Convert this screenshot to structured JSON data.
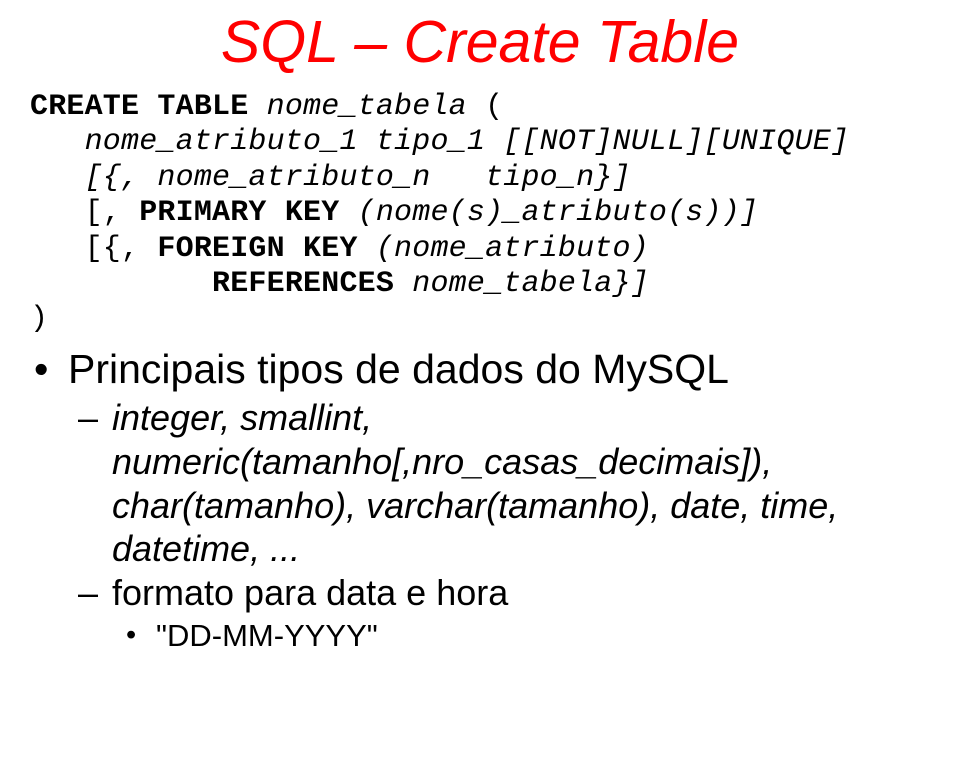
{
  "title": "SQL – Create Table",
  "code": {
    "l1a": "CREATE TABLE ",
    "l1b": "nome_tabela",
    "l1c": " (",
    "l2": "   nome_atributo_1 tipo_1 [[NOT]NULL][UNIQUE]",
    "l3": "   [{, nome_atributo_n   tipo_n}]",
    "l4a": "   [, ",
    "l4b": "PRIMARY KEY ",
    "l4c": "(nome(s)_atributo(s))]",
    "l5a": "   [{, ",
    "l5b": "FOREIGN KEY ",
    "l5c": "(nome_atributo)",
    "l6a": "          ",
    "l6b": "REFERENCES ",
    "l6c": "nome_tabela}]",
    "l7": ")"
  },
  "bullets": {
    "main": "Principais tipos de dados do MySQL",
    "sub1": "integer, smallint, numeric(tamanho[,nro_casas_decimais]), char(tamanho), varchar(tamanho), date, time, datetime, ...",
    "sub2": "formato para data e hora",
    "sub2a": "\"DD-MM-YYYY\""
  }
}
